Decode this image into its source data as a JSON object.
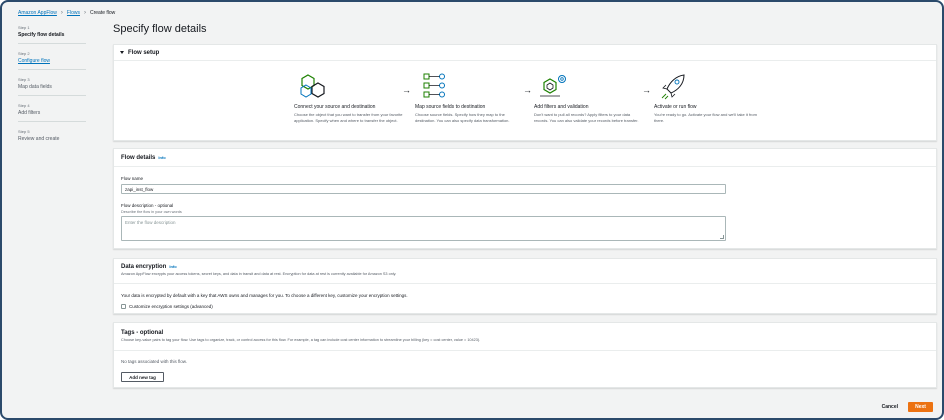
{
  "breadcrumb": {
    "items": [
      "Amazon AppFlow",
      "Flows",
      "Create flow"
    ]
  },
  "steps": [
    {
      "num": "Step 1",
      "label": "Specify flow details"
    },
    {
      "num": "Step 2",
      "label": "Configure flow"
    },
    {
      "num": "Step 3",
      "label": "Map data fields"
    },
    {
      "num": "Step 4",
      "label": "Add filters"
    },
    {
      "num": "Step 5",
      "label": "Review and create"
    }
  ],
  "page_title": "Specify flow details",
  "flow_setup": {
    "title": "Flow setup",
    "steps": [
      {
        "title": "Connect your source and destination",
        "desc": "Choose the object that you want to transfer from your favorite application. Specify when and where to transfer the object."
      },
      {
        "title": "Map source fields to destination",
        "desc": "Choose source fields. Specify how they map to the destination. You can also specify data transformation."
      },
      {
        "title": "Add filters and validation",
        "desc": "Don't want to pull all records? Apply filters to your data records. You can also validate your records before transfer."
      },
      {
        "title": "Activate or run flow",
        "desc": "You're ready to go. Activate your flow and we'll take it from there."
      }
    ],
    "arrow": "→"
  },
  "flow_details": {
    "title": "Flow details",
    "info": "Info",
    "name_label": "Flow name",
    "name_value": "zapi_inst_flow",
    "desc_label": "Flow description - optional",
    "desc_sub": "Describe the flow in your own words",
    "desc_placeholder": "Enter the flow description"
  },
  "encryption": {
    "title": "Data encryption",
    "info": "Info",
    "subtitle": "Amazon AppFlow encrypts your access tokens, secret keys, and data in transit and data at rest. Encryption for data at rest is currently available for Amazon S3 only.",
    "text": "Your data is encrypted by default with a key that AWS owns and manages for you. To choose a different key, customize your encryption settings.",
    "checkbox_label": "Customize encryption settings (advanced)"
  },
  "tags": {
    "title": "Tags - optional",
    "subtitle": "Choose key-value pairs to tag your flow. Use tags to organize, track, or control access for this flow. For example, a tag can include cost center information to streamline your billing (key = cost center, value = 10423).",
    "empty": "No tags associated with this flow.",
    "add_button": "Add new tag"
  },
  "footer": {
    "cancel": "Cancel",
    "next": "Next"
  },
  "colors": {
    "link": "#0073bb",
    "primary": "#ec7211",
    "illustration_green": "#1d8102",
    "illustration_blue": "#0073bb"
  }
}
